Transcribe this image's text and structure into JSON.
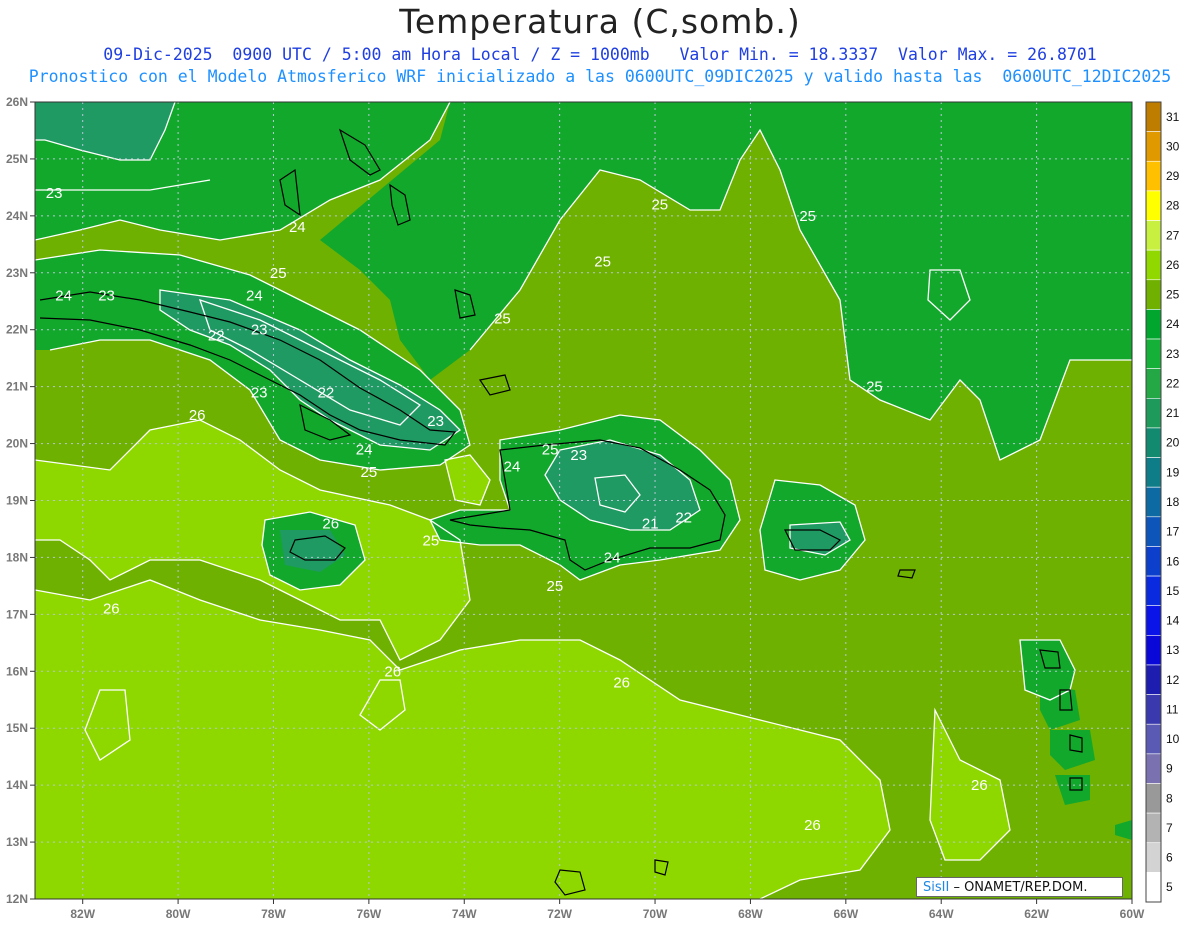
{
  "header": {
    "title": "Temperatura (C,somb.)",
    "line1": "09-Dic-2025  0900 UTC / 5:00 am Hora Local / Z = 1000mb   Valor Min. = 18.3337  Valor Max. = 26.8701",
    "line2": "Pronostico con el Modelo Atmosferico WRF inicializado a las 0600UTC_09DIC2025 y valido hasta las  0600UTC_12DIC2025"
  },
  "credit": {
    "brand": "Sis",
    "mark": "II",
    "text": " – ONAMET/REP.DOM."
  },
  "axes": {
    "lon": [
      "82W",
      "80W",
      "78W",
      "76W",
      "74W",
      "72W",
      "70W",
      "68W",
      "66W",
      "64W",
      "62W",
      "60W"
    ],
    "lat": [
      "26N",
      "25N",
      "24N",
      "23N",
      "22N",
      "21N",
      "20N",
      "19N",
      "18N",
      "17N",
      "16N",
      "15N",
      "14N",
      "13N",
      "12N"
    ]
  },
  "colorbar": {
    "labels": [
      "31",
      "30",
      "29",
      "28",
      "27",
      "26",
      "25",
      "24",
      "23",
      "22",
      "21",
      "20",
      "19",
      "18",
      "17",
      "16",
      "15",
      "14",
      "13",
      "12",
      "11",
      "10",
      "9",
      "8",
      "7",
      "6",
      "5"
    ],
    "colors": [
      "#bf7d00",
      "#e09a00",
      "#ffc000",
      "#ffff00",
      "#c8f040",
      "#90d800",
      "#6fb000",
      "#00a62e",
      "#15b038",
      "#24a845",
      "#1e9a5a",
      "#128a70",
      "#0f7d88",
      "#0e6aa2",
      "#0d55b8",
      "#0b3fcc",
      "#0a2adf",
      "#0a14e8",
      "#0a08d8",
      "#1d1db0",
      "#3a3aae",
      "#5a5ab4",
      "#7a72b0",
      "#999999",
      "#b3b3b3",
      "#d3d3d3",
      "#ffffff"
    ]
  },
  "map_regions": {
    "background": "#6eb100",
    "caribbean_warm": "#8ed800",
    "north_cool": "#12a82c",
    "cool_land": "#1f9a62"
  },
  "contour_labels": [
    {
      "text": "23",
      "lon": -82.6,
      "lat": 24.4
    },
    {
      "text": "24",
      "lon": -77.5,
      "lat": 23.8
    },
    {
      "text": "25",
      "lon": -71.1,
      "lat": 23.2
    },
    {
      "text": "24",
      "lon": -82.4,
      "lat": 22.6
    },
    {
      "text": "23",
      "lon": -81.5,
      "lat": 22.6
    },
    {
      "text": "25",
      "lon": -77.9,
      "lat": 23.0
    },
    {
      "text": "24",
      "lon": -78.4,
      "lat": 22.6
    },
    {
      "text": "23",
      "lon": -78.3,
      "lat": 22.0
    },
    {
      "text": "22",
      "lon": -79.2,
      "lat": 21.9
    },
    {
      "text": "25",
      "lon": -73.2,
      "lat": 22.2
    },
    {
      "text": "23",
      "lon": -78.3,
      "lat": 20.9
    },
    {
      "text": "22",
      "lon": -76.9,
      "lat": 20.9
    },
    {
      "text": "26",
      "lon": -79.6,
      "lat": 20.5
    },
    {
      "text": "23",
      "lon": -74.6,
      "lat": 20.4
    },
    {
      "text": "24",
      "lon": -76.1,
      "lat": 19.9
    },
    {
      "text": "25",
      "lon": -76.0,
      "lat": 19.5
    },
    {
      "text": "25",
      "lon": -72.2,
      "lat": 19.9
    },
    {
      "text": "23",
      "lon": -71.6,
      "lat": 19.8
    },
    {
      "text": "24",
      "lon": -73.0,
      "lat": 19.6
    },
    {
      "text": "21",
      "lon": -70.1,
      "lat": 18.6
    },
    {
      "text": "22",
      "lon": -69.4,
      "lat": 18.7
    },
    {
      "text": "26",
      "lon": -76.8,
      "lat": 18.6
    },
    {
      "text": "25",
      "lon": -74.7,
      "lat": 18.3
    },
    {
      "text": "24",
      "lon": -70.9,
      "lat": 18.0
    },
    {
      "text": "25",
      "lon": -72.1,
      "lat": 17.5
    },
    {
      "text": "26",
      "lon": -81.4,
      "lat": 17.1
    },
    {
      "text": "26",
      "lon": -75.5,
      "lat": 16.0
    },
    {
      "text": "26",
      "lon": -70.7,
      "lat": 15.8
    },
    {
      "text": "25",
      "lon": -69.9,
      "lat": 24.2
    },
    {
      "text": "25",
      "lon": -66.8,
      "lat": 24.0
    },
    {
      "text": "25",
      "lon": -65.4,
      "lat": 21.0
    },
    {
      "text": "26",
      "lon": -63.2,
      "lat": 14.0
    },
    {
      "text": "26",
      "lon": -66.7,
      "lat": 13.3
    }
  ]
}
